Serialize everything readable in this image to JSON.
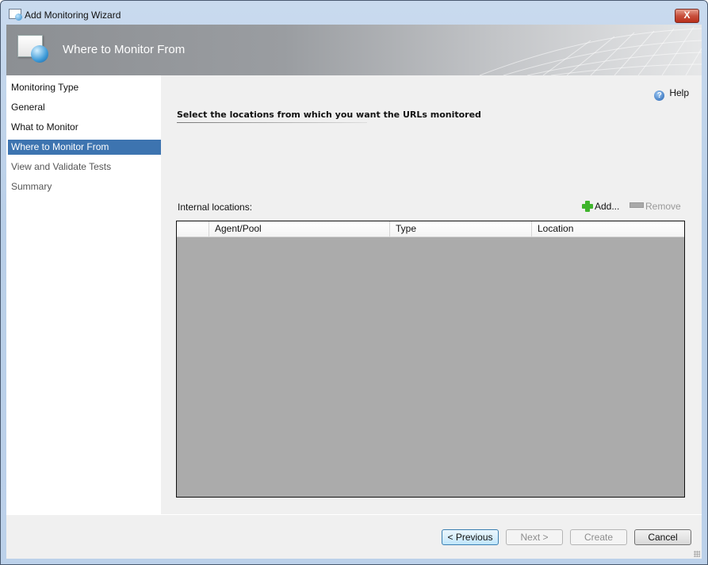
{
  "window": {
    "title": "Add Monitoring Wizard",
    "close_label": "X"
  },
  "banner": {
    "title": "Where to Monitor From"
  },
  "nav": {
    "items": [
      {
        "label": "Monitoring Type",
        "state": "done"
      },
      {
        "label": "General",
        "state": "done"
      },
      {
        "label": "What to Monitor",
        "state": "done"
      },
      {
        "label": "Where to Monitor From",
        "state": "active"
      },
      {
        "label": "View and Validate Tests",
        "state": "future"
      },
      {
        "label": "Summary",
        "state": "future"
      }
    ]
  },
  "main": {
    "help_label": "Help",
    "heading": "Select the locations from which you want the URLs monitored",
    "internal_locations_label": "Internal locations:",
    "add_label": "Add...",
    "remove_label": "Remove",
    "grid": {
      "columns": [
        "",
        "Agent/Pool",
        "Type",
        "Location"
      ],
      "rows": []
    }
  },
  "footer": {
    "previous_label": "< Previous",
    "next_label": "Next >",
    "create_label": "Create",
    "cancel_label": "Cancel"
  },
  "colors": {
    "accent": "#3d74b0",
    "grid_bg": "#ababab"
  }
}
